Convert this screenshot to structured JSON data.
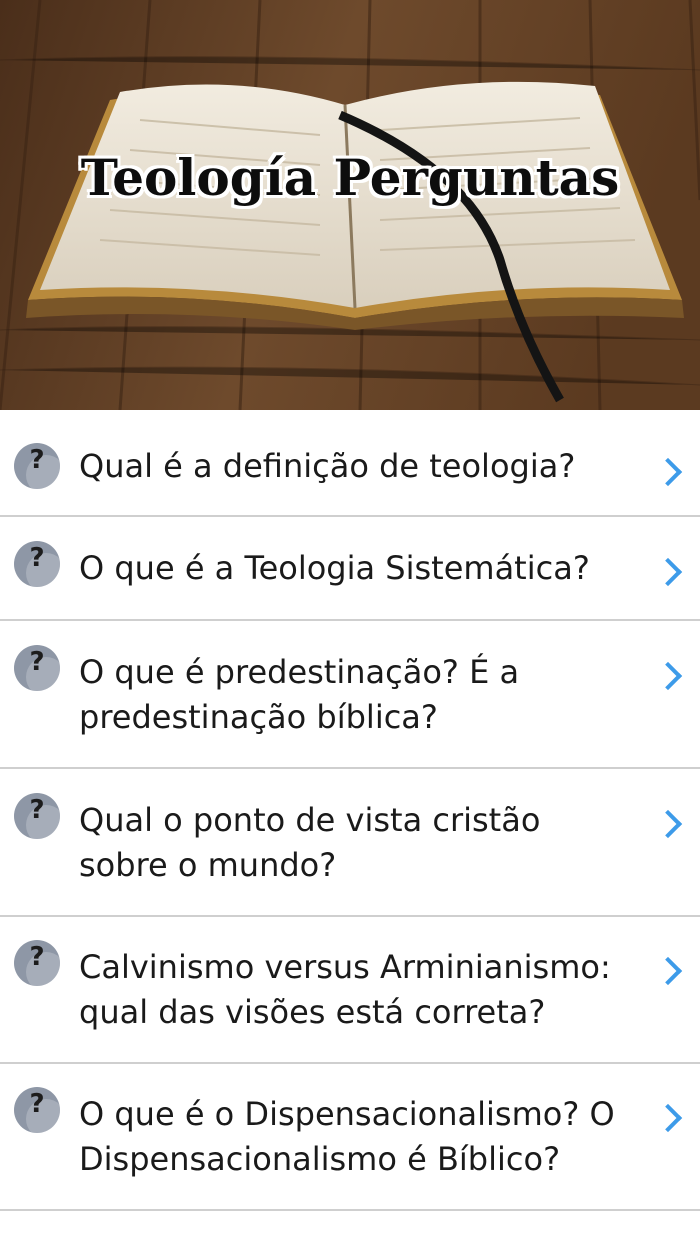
{
  "header": {
    "title": "Teología Perguntas",
    "image_alt": "open-bible-on-wooden-table"
  },
  "colors": {
    "chevron": "#3d9be9",
    "divider": "#cfcfcf",
    "icon_bg": "#8e97a6",
    "text": "#1a1a1a"
  },
  "items": [
    {
      "icon": "question-mark-icon",
      "glyph": "?",
      "label": "Qual é a definição de teologia?"
    },
    {
      "icon": "question-mark-icon",
      "glyph": "?",
      "label": "O que é a Teologia Sistemática?"
    },
    {
      "icon": "question-mark-icon",
      "glyph": "?",
      "label": "O que é predestinação? É a predestinação bíblica?"
    },
    {
      "icon": "question-mark-icon",
      "glyph": "?",
      "label": "Qual o ponto de vista cristão sobre o mundo?"
    },
    {
      "icon": "question-mark-icon",
      "glyph": "?",
      "label": "Calvinismo versus Arminianismo: qual das visões está correta?"
    },
    {
      "icon": "question-mark-icon",
      "glyph": "?",
      "label": "O que é o Dispensacionalismo? O Dispensacionalismo é Bíblico?"
    }
  ]
}
